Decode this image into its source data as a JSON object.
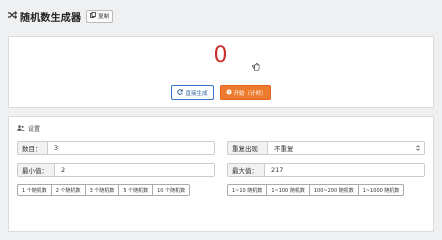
{
  "header": {
    "title": "随机数生成器",
    "copy_label": "复制"
  },
  "result": {
    "value": "0"
  },
  "actions": {
    "reset_label": "直接生成",
    "start_label": "开始（计时）"
  },
  "settings": {
    "title": "设置",
    "count_label": "数目：",
    "count_value": "3",
    "repeat_label": "重复出现",
    "repeat_value": "不重复",
    "min_label": "最小值：",
    "min_value": "2",
    "max_label": "最大值：",
    "max_value": "217",
    "count_presets": [
      "1 个随机数",
      "2 个随机数",
      "3 个随机数",
      "5 个随机数",
      "10 个随机数"
    ],
    "range_presets": [
      "1~10 随机数",
      "1~100 随机数",
      "100~200 随机数",
      "1~1000 随机数"
    ]
  }
}
